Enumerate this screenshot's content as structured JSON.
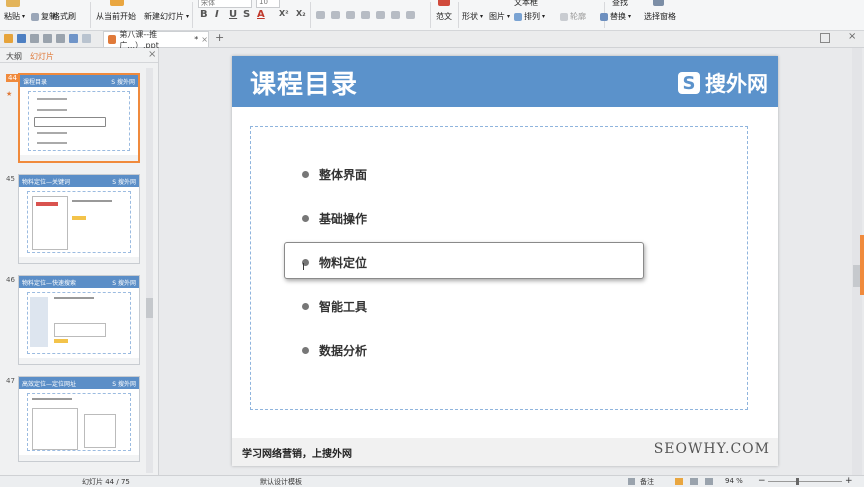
{
  "ribbon": {
    "paste": "粘贴",
    "copy": "复制",
    "format_painter": "格式刷",
    "from_current": "从当前开始",
    "new_slide": "新建幻灯片",
    "font_name": "宋体",
    "font_size": "10",
    "bold": "B",
    "italic": "I",
    "underline": "U",
    "strike": "S",
    "font_color": "A",
    "superscript": "X²",
    "subscript": "X₂",
    "template": "范文",
    "shape": "形状",
    "picture": "图片",
    "arrange": "排列",
    "textbox": "文本框",
    "outline": "轮廓",
    "find": "查找",
    "replace": "替换",
    "select_pane": "选择窗格"
  },
  "tabs": {
    "doc_title": "第八课--推广...）.ppt",
    "modified_mark": "*",
    "close": "×",
    "add": "+"
  },
  "left_panel": {
    "outline_tab": "大纲",
    "slides_tab": "幻灯片",
    "thumbs": [
      {
        "num": "44",
        "title": "课程目录",
        "logo": "S 搜外网"
      },
      {
        "num": "45",
        "title": "物料定位—关键词",
        "logo": "S 搜外网"
      },
      {
        "num": "46",
        "title": "物料定位—快速搜索",
        "logo": "S 搜外网"
      },
      {
        "num": "47",
        "title": "高效定位—定位网址",
        "logo": "S 搜外网"
      }
    ]
  },
  "slide": {
    "title": "课程目录",
    "logo_mark": "S",
    "logo_text": "搜外网",
    "items": [
      "整体界面",
      "基础操作",
      "物料定位",
      "智能工具",
      "数据分析"
    ],
    "footer_left": "学习网络营销，上搜外网",
    "footer_right": "SEOWHY.COM"
  },
  "status": {
    "slide_counter": "幻灯片 44 / 75",
    "theme": "默认设计模板",
    "notes": "备注",
    "zoom": "94 %",
    "minus": "−",
    "plus": "+"
  },
  "colors": {
    "accent": "#5b92cb",
    "thumb_selected": "#f08a3c"
  }
}
